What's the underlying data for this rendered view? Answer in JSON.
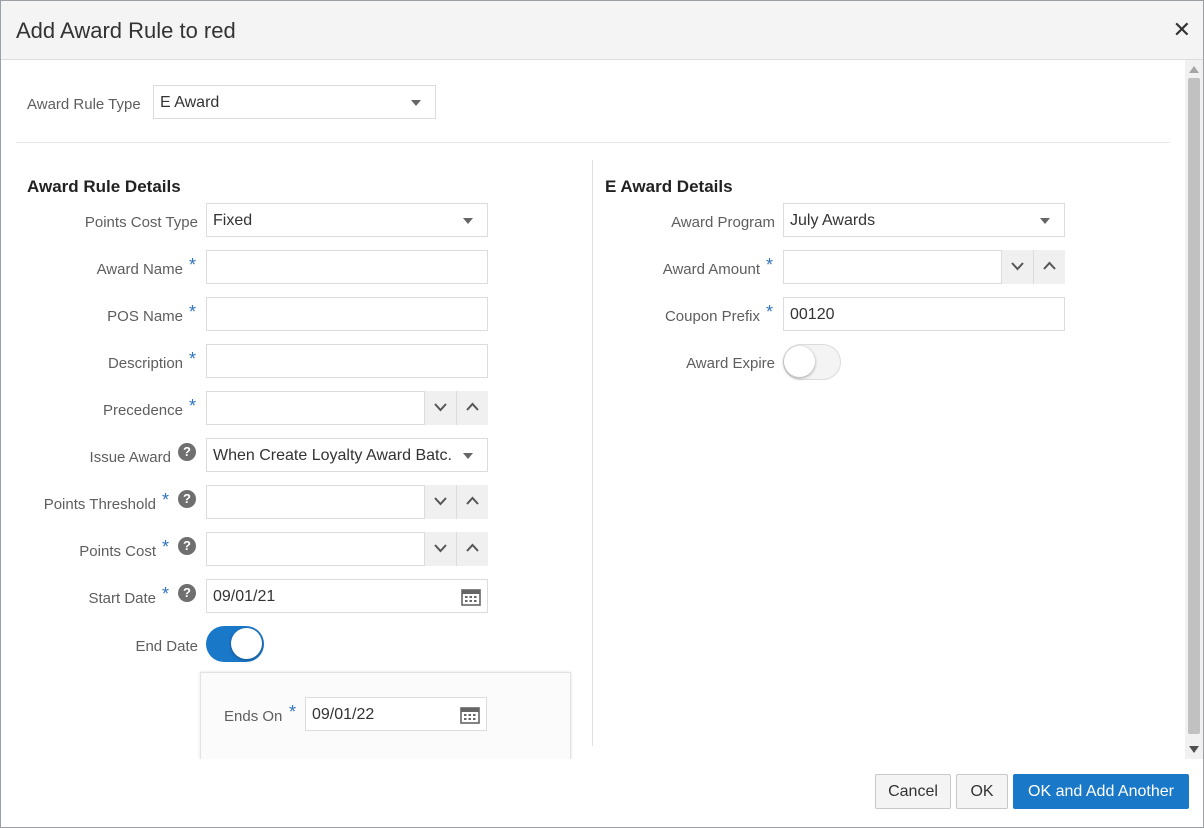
{
  "dialog": {
    "title": "Add Award Rule to red"
  },
  "icons": {
    "close": "close-icon",
    "caret": "caret-down-icon",
    "spin_down": "chevron-down-icon",
    "spin_up": "chevron-up-icon",
    "calendar": "calendar-icon",
    "help": "help-icon"
  },
  "top": {
    "award_rule_type_label": "Award Rule Type",
    "award_rule_type_value": "E Award"
  },
  "award_rule_details": {
    "title": "Award Rule Details",
    "points_cost_type_label": "Points Cost Type",
    "points_cost_type_value": "Fixed",
    "award_name_label": "Award Name",
    "award_name_value": "",
    "pos_name_label": "POS Name",
    "pos_name_value": "",
    "description_label": "Description",
    "description_value": "",
    "precedence_label": "Precedence",
    "precedence_value": "",
    "issue_award_label": "Issue Award",
    "issue_award_value": "When Create Loyalty Award Batc...",
    "points_threshold_label": "Points Threshold",
    "points_threshold_value": "",
    "points_cost_label": "Points Cost",
    "points_cost_value": "",
    "start_date_label": "Start Date",
    "start_date_value": "09/01/21",
    "end_date_label": "End Date",
    "end_date_enabled": true,
    "ends_on_label": "Ends On",
    "ends_on_value": "09/01/22"
  },
  "e_award_details": {
    "title": "E Award Details",
    "award_program_label": "Award Program",
    "award_program_value": "July Awards",
    "award_amount_label": "Award Amount",
    "award_amount_value": "",
    "coupon_prefix_label": "Coupon Prefix",
    "coupon_prefix_value": "00120",
    "award_expire_label": "Award Expire",
    "award_expire_enabled": false
  },
  "required_marker": "*",
  "help_glyph": "?",
  "footer": {
    "cancel_label": "Cancel",
    "ok_label": "OK",
    "ok_add_label": "OK and Add Another"
  },
  "colors": {
    "primary": "#1a78c9",
    "required": "#2f74c0"
  }
}
